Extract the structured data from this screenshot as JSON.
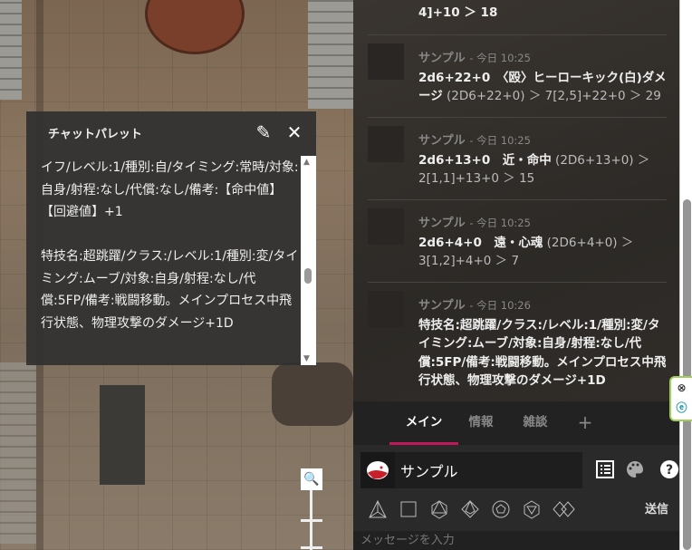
{
  "palette": {
    "title": "チャットパレット",
    "text": "イフ/レベル:1/種別:自/タイミング:常時/対象:自身/射程:なし/代償:なし/備考:【命中値】【回避値】+1\n\n特技名:超跳躍/クラス:/レベル:1/種別:変/タイミング:ムーブ/対象:自身/射程:なし/代償:5FP/備考:戦闘移動。メインプロセス中飛行状態、物理攻撃のダメージ+1D"
  },
  "chat": {
    "partial": "4]+10 ＞ 18",
    "messages": [
      {
        "name": "サンプル",
        "time": "- 今日 10:25",
        "cmd": "2d6+22+0　〈殴〉ヒーローキック(白)ダメージ",
        "result": " (2D6+22+0) ＞ 7[2,5]+22+0 ＞ 29"
      },
      {
        "name": "サンプル",
        "time": "- 今日 10:25",
        "cmd": "2d6+13+0　近・命中",
        "result": " (2D6+13+0) ＞ 2[1,1]+13+0 ＞ 15"
      },
      {
        "name": "サンプル",
        "time": "- 今日 10:25",
        "cmd": "2d6+4+0　遠・心魂",
        "result": " (2D6+4+0) ＞ 3[1,2]+4+0 ＞ 7"
      },
      {
        "name": "サンプル",
        "time": "- 今日 10:26",
        "cmd": "特技名:超跳躍/クラス:/レベル:1/種別:変/タイミング:ムーブ/対象:自身/射程:なし/代償:5FP/備考:戦闘移動。メインプロセス中飛行状態、物理攻撃のダメージ+1D",
        "result": ""
      }
    ]
  },
  "tabs": [
    "メイン",
    "情報",
    "雑談",
    "+"
  ],
  "input": {
    "character": "サンプル",
    "send": "送信",
    "placeholder": "メッセージを入力"
  },
  "colors": {
    "accent": "#c2185b"
  }
}
